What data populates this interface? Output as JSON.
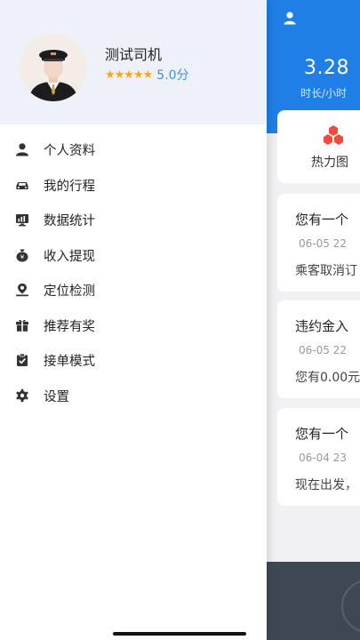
{
  "background_app": {
    "hours_value": "3.28",
    "hours_label": "时长/小时",
    "heatmap_label": "热力图",
    "messages": [
      {
        "title": "您有一个",
        "date": "06-05 22",
        "body": "乘客取消订"
      },
      {
        "title": "违约金入",
        "date": "06-05 22",
        "body": "您有0.00元"
      },
      {
        "title": "您有一个",
        "date": "06-04 23",
        "body": "现在出发，"
      }
    ],
    "colors": {
      "header": "#1f7fe6",
      "bottom": "#3e4855"
    }
  },
  "drawer": {
    "driver_name": "测试司机",
    "rating_stars": "★★★★★",
    "rating_score": "5.0分",
    "menu": [
      {
        "label": "个人资料",
        "icon": "user-icon"
      },
      {
        "label": "我的行程",
        "icon": "car-icon"
      },
      {
        "label": "数据统计",
        "icon": "stats-icon"
      },
      {
        "label": "收入提现",
        "icon": "money-bag-icon"
      },
      {
        "label": "定位检测",
        "icon": "location-check-icon"
      },
      {
        "label": "推荐有奖",
        "icon": "gift-icon"
      },
      {
        "label": "接单模式",
        "icon": "clipboard-check-icon"
      },
      {
        "label": "设置",
        "icon": "gear-icon"
      }
    ],
    "colors": {
      "header_bg": "#eef1f7",
      "star": "#f5a623",
      "score": "#3d8fe6"
    }
  }
}
